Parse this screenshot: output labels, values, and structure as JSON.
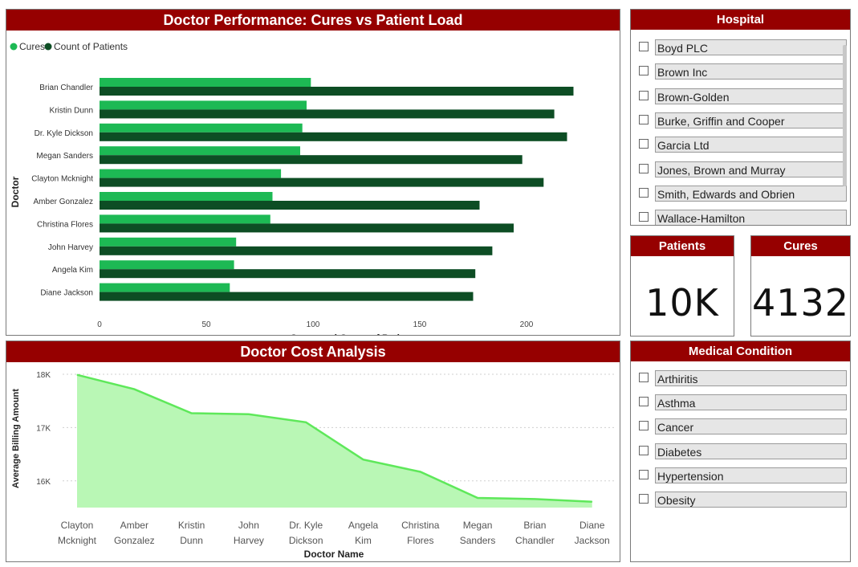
{
  "colors": {
    "title_bg": "#960000",
    "cures": "#1db954",
    "patients": "#0d4d24",
    "area_fill": "#b9f7b5",
    "area_line": "#5ee85a"
  },
  "performance_chart": {
    "title": "Doctor Performance: Cures vs Patient Load",
    "legend": [
      "Cures",
      "Count of Patients"
    ],
    "chart_data": {
      "type": "bar",
      "orientation": "horizontal",
      "categories": [
        "Brian Chandler",
        "Kristin Dunn",
        "Dr. Kyle Dickson",
        "Megan Sanders",
        "Clayton Mcknight",
        "Amber Gonzalez",
        "Christina Flores",
        "John Harvey",
        "Angela Kim",
        "Diane Jackson"
      ],
      "series": [
        {
          "name": "Cures",
          "values": [
            99,
            97,
            95,
            94,
            85,
            81,
            80,
            64,
            63,
            61
          ]
        },
        {
          "name": "Count of Patients",
          "values": [
            222,
            213,
            219,
            198,
            208,
            178,
            194,
            184,
            176,
            175
          ]
        }
      ],
      "xlabel": "Cures and Count of Patients",
      "ylabel": "Doctor",
      "xlim": [
        0,
        230
      ],
      "xticks": [
        0,
        50,
        100,
        150,
        200
      ],
      "legend_position": "top-left"
    }
  },
  "hospital_slicer": {
    "title": "Hospital",
    "items": [
      "Boyd PLC",
      "Brown Inc",
      "Brown-Golden",
      "Burke, Griffin and Cooper",
      "Garcia Ltd",
      "Jones, Brown and Murray",
      "Smith, Edwards and Obrien",
      "Wallace-Hamilton"
    ]
  },
  "kpi_patients": {
    "title": "Patients",
    "value": "10K"
  },
  "kpi_cures": {
    "title": "Cures",
    "value": "4132"
  },
  "cost_chart": {
    "title": "Doctor Cost Analysis",
    "chart_data": {
      "type": "area",
      "categories": [
        "Clayton Mcknight",
        "Amber Gonzalez",
        "Kristin Dunn",
        "John Harvey",
        "Dr. Kyle Dickson",
        "Angela Kim",
        "Christina Flores",
        "Megan Sanders",
        "Brian Chandler",
        "Diane Jackson"
      ],
      "category_lines": [
        [
          "Clayton",
          "Mcknight"
        ],
        [
          "Amber",
          "Gonzalez"
        ],
        [
          "Kristin",
          "Dunn"
        ],
        [
          "John",
          "Harvey"
        ],
        [
          "Dr. Kyle",
          "Dickson"
        ],
        [
          "Angela",
          "Kim"
        ],
        [
          "Christina",
          "Flores"
        ],
        [
          "Megan",
          "Sanders"
        ],
        [
          "Brian",
          "Chandler"
        ],
        [
          "Diane",
          "Jackson"
        ]
      ],
      "values": [
        17990,
        17720,
        17270,
        17250,
        17100,
        16400,
        16170,
        15680,
        15660,
        15610
      ],
      "xlabel": "Doctor Name",
      "ylabel": "Average Billing Amount",
      "yticks": [
        18000,
        17000,
        16000
      ],
      "ytick_labels": [
        "18K",
        "17K",
        "16K"
      ],
      "ylim": [
        15500,
        18000
      ],
      "grid": true
    }
  },
  "condition_slicer": {
    "title": "Medical Condition",
    "items": [
      "Arthiritis",
      "Asthma",
      "Cancer",
      "Diabetes",
      "Hypertension",
      "Obesity"
    ]
  }
}
